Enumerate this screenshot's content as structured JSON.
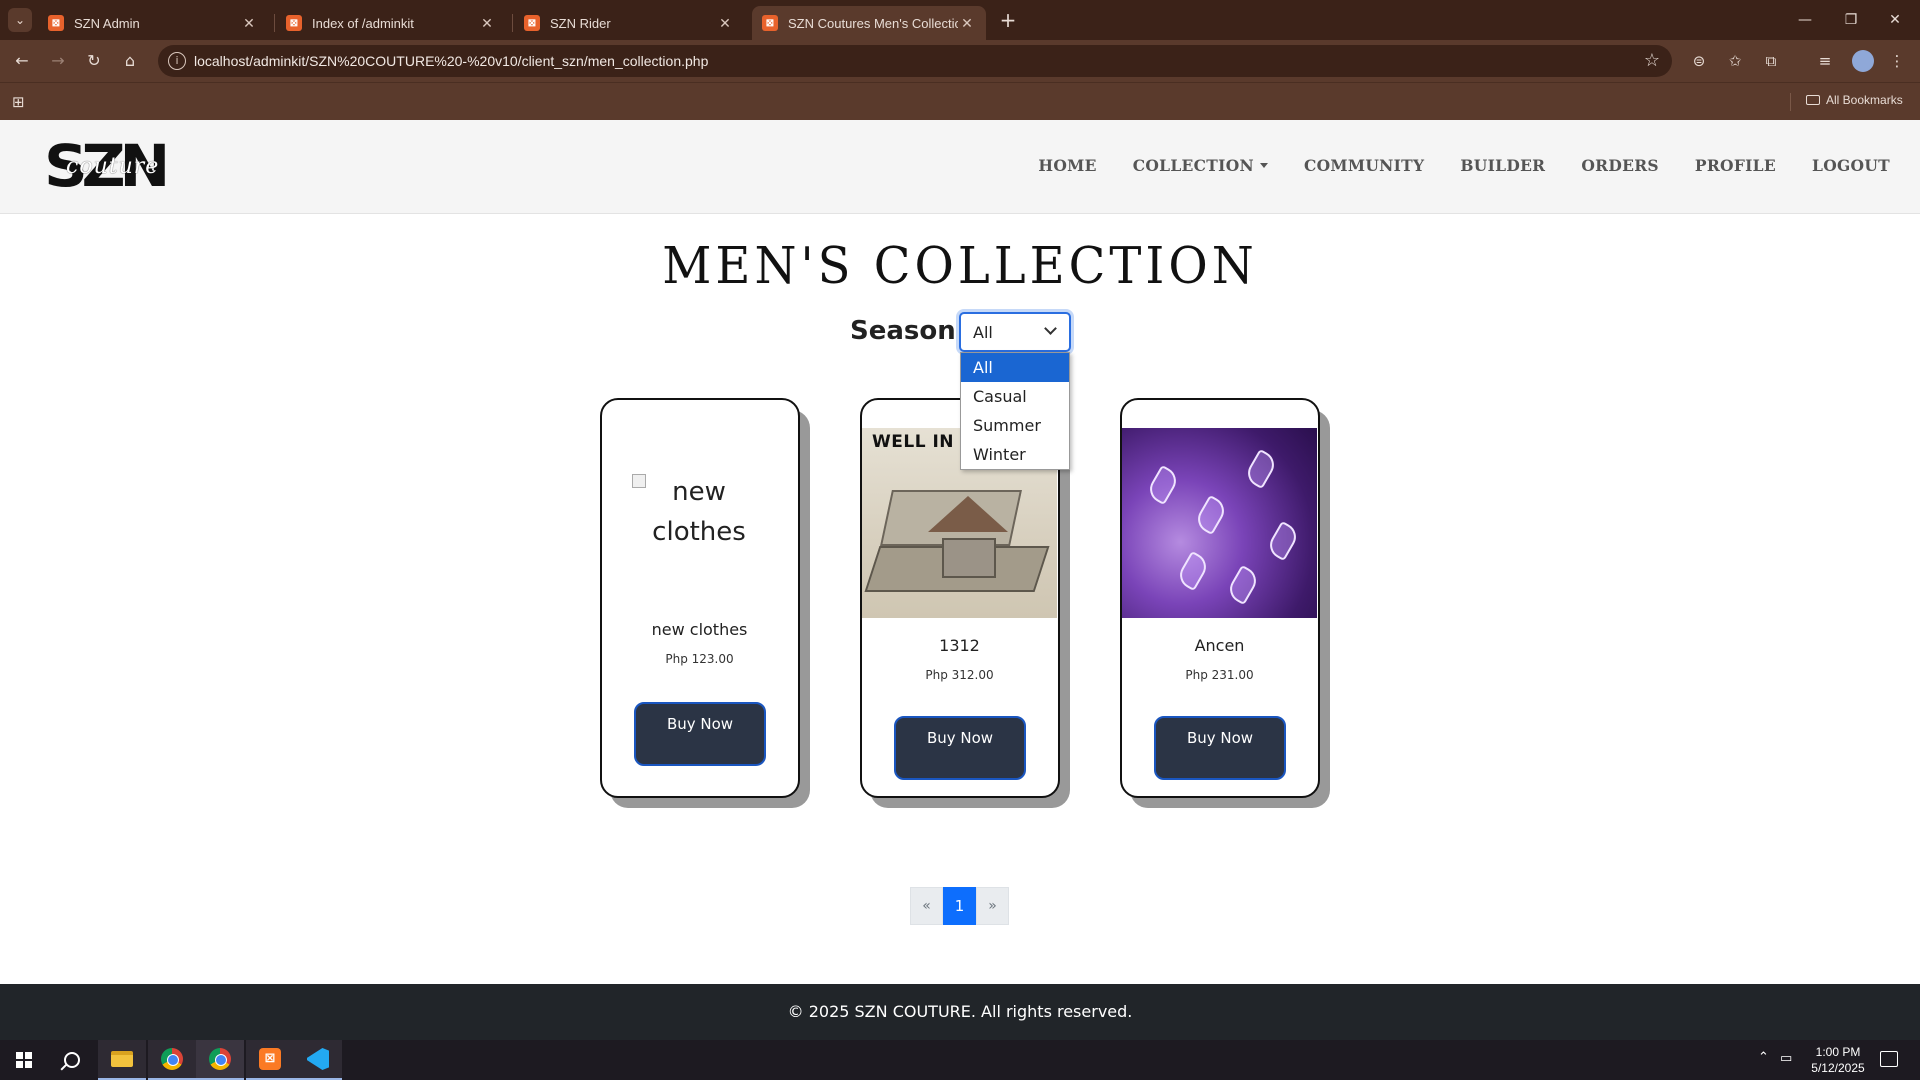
{
  "browser": {
    "tabs": [
      {
        "title": "SZN Admin",
        "active": false
      },
      {
        "title": "Index of /adminkit",
        "active": false
      },
      {
        "title": "SZN Rider",
        "active": false
      },
      {
        "title": "SZN Coutures Men's Collection",
        "active": true
      }
    ],
    "new_tab_label": "+",
    "url": "localhost/adminkit/SZN%20COUTURE%20-%20v10/client_szn/men_collection.php",
    "bookmarks_label": "All Bookmarks"
  },
  "site": {
    "logo_main": "SZN",
    "logo_script": "couture",
    "nav": [
      {
        "label": "HOME"
      },
      {
        "label": "COLLECTION",
        "dropdown": true
      },
      {
        "label": "COMMUNITY"
      },
      {
        "label": "BUILDER"
      },
      {
        "label": "ORDERS"
      },
      {
        "label": "PROFILE"
      },
      {
        "label": "LOGOUT"
      }
    ]
  },
  "page": {
    "title": "MEN'S COLLECTION",
    "season_label": "Season:",
    "season_selected": "All",
    "season_options": [
      "All",
      "Casual",
      "Summer",
      "Winter"
    ]
  },
  "products": [
    {
      "name": "new clothes",
      "price": "Php 123.00",
      "image_alt": "new clothes",
      "image": "broken",
      "button": "Buy Now"
    },
    {
      "name": "1312",
      "price": "Php 312.00",
      "image_text": "WELL IN T",
      "image": "well",
      "button": "Buy Now"
    },
    {
      "name": "Ancen",
      "price": "Php 231.00",
      "image": "cosmic",
      "button": "Buy Now"
    }
  ],
  "pagination": {
    "prev": "«",
    "current": "1",
    "next": "»"
  },
  "footer": {
    "text": "© 2025 SZN COUTURE. All rights reserved."
  },
  "taskbar": {
    "apps": [
      "windows-start",
      "search",
      "file-explorer",
      "chrome",
      "chrome",
      "xampp",
      "vscode"
    ],
    "time": "1:00 PM",
    "date": "5/12/2025"
  }
}
